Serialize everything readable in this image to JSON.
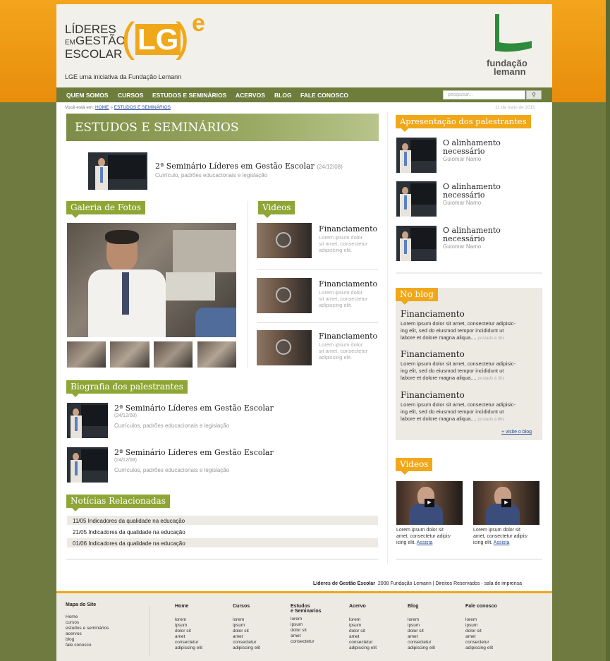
{
  "brand": {
    "logo_line1": "LÍDERES",
    "logo_line2a": "EM",
    "logo_line2b": "GESTÃO",
    "logo_line3": "ESCOLAR",
    "logo_mark": "LG",
    "logo_e": "e",
    "tagline": "LGE uma iniciativa da Fundação Lemann",
    "partner_line1": "fundação",
    "partner_line2": "lemann"
  },
  "nav": {
    "items": [
      "QUEM SOMOS",
      "CURSOS",
      "ESTUDOS E SEMINÁRIOS",
      "ACERVOS",
      "BLOG",
      "FALE CONOSCO"
    ],
    "search_placeholder": "pesquisar..."
  },
  "breadcrumb": {
    "prefix": "Você está em:",
    "home": "HOME",
    "sep": " » ",
    "current": "ESTUDOS E SEMINÁRIOS",
    "date": "11 de maio de 2010"
  },
  "main": {
    "page_title": "ESTUDOS E SEMINÁRIOS",
    "featured": {
      "title": "2ª Seminário Líderes em Gestão Escolar",
      "date": "(24/12/08)",
      "desc": "Currículo, padrões educacionais e legislação"
    },
    "gallery_title": "Galeria de Fotos",
    "videos_title": "Videos",
    "videos": [
      {
        "title": "Financiamento",
        "desc1": "Lorem ipsum dolor",
        "desc2": "sit amet, consectetur",
        "desc3": "adipiscing elit."
      },
      {
        "title": "Financiamento",
        "desc1": "Lorem ipsum dolor",
        "desc2": "sit amet, consectetur",
        "desc3": "adipiscing elit."
      },
      {
        "title": "Financiamento",
        "desc1": "Lorem ipsum dolor",
        "desc2": "sit amet, consectetur",
        "desc3": "adipiscing elit."
      }
    ],
    "bio_title": "Biografia dos palestrantes",
    "bios": [
      {
        "title": "2ª Seminário Líderes em Gestão Escolar",
        "date": "(24/12/08)",
        "desc": "Currículos, padrões educacionais e legislação"
      },
      {
        "title": "2ª Seminário Líderes em Gestão Escolar",
        "date": "(24/12/08)",
        "desc": "Currículos, padrões educacionais e legislação"
      }
    ],
    "news_title": "Notícias Relacionadas",
    "news": [
      "11/05 Indicadores da qualidade na educação",
      "21/05 Indicadores da qualidade na educação",
      "01/06 Indicadores da qualidade na educação"
    ]
  },
  "sidebar": {
    "speakers_title": "Apresentação dos palestrantes",
    "speakers": [
      {
        "title1": "O alinhamento",
        "title2": "necessário",
        "name": "Guiomar Namo"
      },
      {
        "title1": "O alinhamento",
        "title2": "necessário",
        "name": "Guiomar Namo"
      },
      {
        "title1": "O alinhamento",
        "title2": "necessário",
        "name": "Guiomar Namo"
      }
    ],
    "blog_title": "No blog",
    "blog_posts": [
      {
        "title": "Financiamento",
        "l1": "Lorem ipsum dolor sit amet, consectetur adipisic-",
        "l2": "ing elit, sed do eiusmod tempor incididunt ut",
        "l3": "labore et dolore magna aliqua....",
        "meta": "postado à 3hs"
      },
      {
        "title": "Financiamento",
        "l1": "Lorem ipsum dolor sit amet, consectetur adipisic-",
        "l2": "ing elit, sed do eiusmod tempor incididunt ut",
        "l3": "labore et dolore magna aliqua....",
        "meta": "postado à 3hs"
      },
      {
        "title": "Financiamento",
        "l1": "Lorem ipsum dolor sit amet, consectetur adipisic-",
        "l2": "ing elit, sed do eiusmod tempor incididunt ut",
        "l3": "labore et dolore magna aliqua....",
        "meta": "postado à 8hs"
      }
    ],
    "blog_link": "+ visite o blog",
    "videos_title": "Videos",
    "videos": [
      {
        "l1": "Lorem ipsum dolor sit",
        "l2": "amet, consectetur adipis-",
        "l3": "icing elit.",
        "link": "Assista"
      },
      {
        "l1": "Lorem ipsum dolor sit",
        "l2": "amet, consectetur adipis-",
        "l3": "icing elit.",
        "link": "Assista"
      }
    ]
  },
  "footer": {
    "credit_bold": "Líderes de Gestão Escolar",
    "credit_rest": "2008 Fundação Lemann | Direitos Reservados - sala de imprensa",
    "sitemap_title": "Mapa do Site",
    "sitemap": [
      "Home",
      "cursos",
      "estudos e seminários",
      "acervos",
      "blog",
      "fale conosco"
    ],
    "columns": [
      {
        "title": "Home",
        "title2": "",
        "items": [
          "lorem",
          "ipsum",
          "dolor sit",
          "amet",
          "consectetur",
          "adipiscing elit"
        ]
      },
      {
        "title": "Cursos",
        "title2": "",
        "items": [
          "lorem",
          "ipsum",
          "dolor sit",
          "amet",
          "consectetur",
          "adipiscing elit"
        ]
      },
      {
        "title": "Estudos",
        "title2": "e Seminarios",
        "items": [
          "lorem",
          "ipsum",
          "dolor sit",
          "amet",
          "consectetur"
        ]
      },
      {
        "title": "Acervo",
        "title2": "",
        "items": [
          "lorem",
          "ipsum",
          "dolor sit",
          "amet",
          "consectetur",
          "adipiscing elit"
        ]
      },
      {
        "title": "Blog",
        "title2": "",
        "items": [
          "lorem",
          "ipsum",
          "dolor sit",
          "amet",
          "consectetur",
          "adipiscing elit"
        ]
      },
      {
        "title": "Fale conosco",
        "title2": "",
        "items": [
          "lorem",
          "ipsum",
          "dolor sit",
          "amet",
          "consectetur",
          "adipiscing elit"
        ]
      }
    ]
  },
  "colors": {
    "orange": "#f0a81a",
    "olive": "#6e7c3c",
    "green_tab": "#8fa637"
  }
}
